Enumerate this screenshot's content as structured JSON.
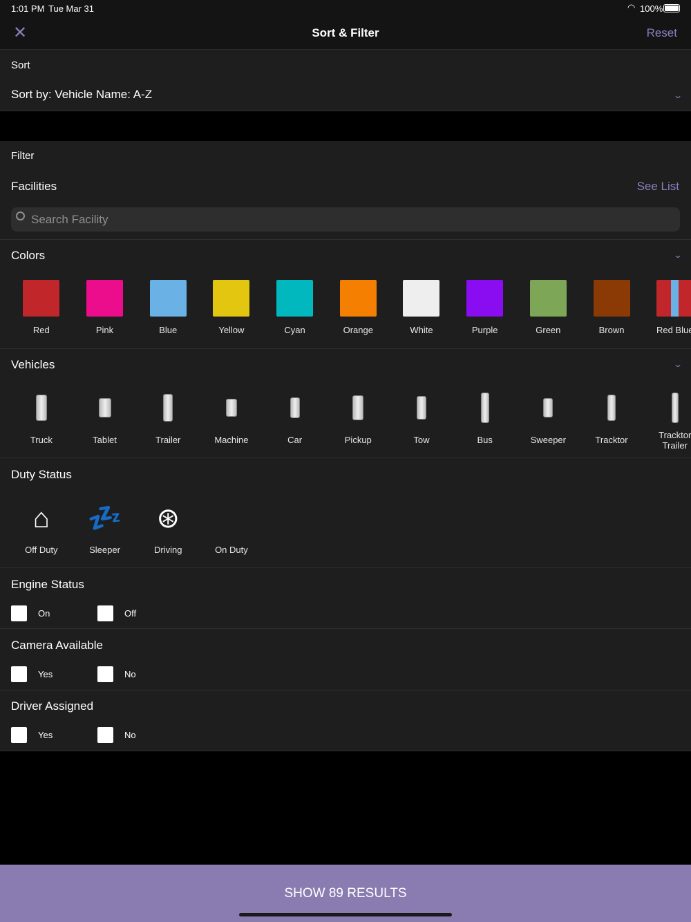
{
  "status_bar": {
    "time": "1:01 PM",
    "date": "Tue Mar 31",
    "battery": "100%"
  },
  "header": {
    "title": "Sort & Filter",
    "reset": "Reset"
  },
  "sort": {
    "label": "Sort",
    "value": "Sort by: Vehicle Name: A-Z"
  },
  "filter": {
    "label": "Filter",
    "facilities": "Facilities",
    "see_list": "See List",
    "search_placeholder": "Search Facility"
  },
  "colors": {
    "title": "Colors",
    "items": [
      {
        "label": "Red",
        "hex": "#c0262a"
      },
      {
        "label": "Pink",
        "hex": "#ec0d8c"
      },
      {
        "label": "Blue",
        "hex": "#6ab2e6"
      },
      {
        "label": "Yellow",
        "hex": "#e2c60f"
      },
      {
        "label": "Cyan",
        "hex": "#00b8bd"
      },
      {
        "label": "Orange",
        "hex": "#f47f00"
      },
      {
        "label": "White",
        "hex": "#eeeeee"
      },
      {
        "label": "Purple",
        "hex": "#8a0cf0"
      },
      {
        "label": "Green",
        "hex": "#7da657"
      },
      {
        "label": "Brown",
        "hex": "#8c3a05"
      },
      {
        "label": "Red Blue",
        "hex": "#c0262a"
      }
    ]
  },
  "vehicles": {
    "title": "Vehicles",
    "items": [
      {
        "label": "Truck"
      },
      {
        "label": "Tablet"
      },
      {
        "label": "Trailer"
      },
      {
        "label": "Machine"
      },
      {
        "label": "Car"
      },
      {
        "label": "Pickup"
      },
      {
        "label": "Tow"
      },
      {
        "label": "Bus"
      },
      {
        "label": "Sweeper"
      },
      {
        "label": "Tracktor"
      },
      {
        "label": "Tracktor Trailer"
      }
    ]
  },
  "duty": {
    "title": "Duty Status",
    "items": [
      {
        "label": "Off Duty",
        "icon": "house-icon"
      },
      {
        "label": "Sleeper",
        "icon": "sleep-icon"
      },
      {
        "label": "Driving",
        "icon": "steering-wheel-icon"
      },
      {
        "label": "On Duty",
        "icon": ""
      }
    ]
  },
  "engine": {
    "title": "Engine Status",
    "opt1": "On",
    "opt2": "Off"
  },
  "camera": {
    "title": "Camera Available",
    "opt1": "Yes",
    "opt2": "No"
  },
  "driver": {
    "title": "Driver Assigned",
    "opt1": "Yes",
    "opt2": "No"
  },
  "footer": {
    "button": "SHOW 89 RESULTS"
  },
  "theme": {
    "accent": "#8b7fc0",
    "button_bg": "#8a7bb0"
  }
}
